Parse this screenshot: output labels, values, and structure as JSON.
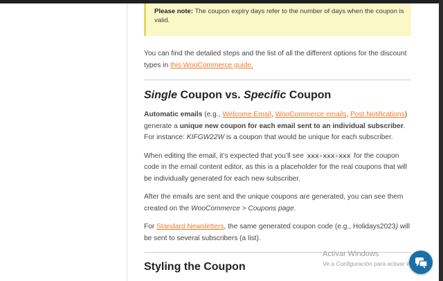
{
  "note": {
    "title": "Please note:",
    "text": "The coupon expiry days refer to the number of days when the coupon is valid."
  },
  "intro": {
    "text": "You can find the detailed steps and the list of all the different options for the discount types in",
    "link": "this WooCommerce guide."
  },
  "section1": {
    "heading_part1": "Single",
    "heading_part2": "Coupon vs.",
    "heading_part3": "Specific",
    "heading_part4": "Coupon",
    "p1": {
      "lead": "Automatic emails",
      "pre": "(e.g.,",
      "link1": "Welcome Email",
      "sep1": ",",
      "link2": "WooCommerce emails",
      "sep2": ",",
      "link3": "Post Notifications",
      "post": ")",
      "text1": "generate a",
      "strong": "unique new coupon for each email sent to an individual subscriber",
      "text2": ". For instance:",
      "example": "KIFGW22W",
      "text3": "is a coupon that would be unique for each subscriber."
    },
    "p2": {
      "text1": "When editing the email, it’s expected that you’ll see",
      "code": "xxx-xxx-xxx",
      "text2": "for the coupon code in the email content editor, as this is a placeholder for the real coupons that will be individually generated for each new subscriber."
    },
    "p3": {
      "text1": "After the emails are sent and the unique coupons are generated, you can see them created on the",
      "em": "WooCommerce > Coupons page",
      "text2": "."
    },
    "p4": {
      "pre": "For",
      "link": "Standard Newsletters",
      "text1": ", the same generated coupon code (e.g., Holidays2023",
      "em": ")",
      "text2": "will be sent to several subscribers (a list)."
    }
  },
  "section2": {
    "heading": "Styling the Coupon"
  },
  "watermark": {
    "line1": "Activar Windows",
    "line2": "Ve a Configuración para activar W"
  },
  "colors": {
    "link": "#f47a2c",
    "note_bg": "#fbf8c8",
    "chat_button": "#1a6fa8"
  },
  "icons": {
    "chat": "chat-bubbles-icon"
  }
}
